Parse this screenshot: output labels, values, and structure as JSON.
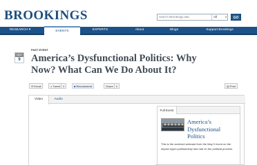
{
  "header": {
    "logo": "BROOKINGS",
    "search": {
      "placeholder": "Search Brookings.edu",
      "scope": "All",
      "go_label": "GO"
    }
  },
  "nav": {
    "items": [
      {
        "label": "RESEARCH ▾"
      },
      {
        "label": "EVENTS"
      },
      {
        "label": "EXPERTS"
      },
      {
        "label": "About"
      },
      {
        "label": "Blogs"
      },
      {
        "label": "Support Brookings"
      }
    ]
  },
  "event": {
    "type": "PAST EVENT",
    "date_month": "MAY",
    "date_day": "9",
    "title": "America’s Dysfunctional Politics: Why Now? What Can We Do About It?"
  },
  "share": {
    "email": "Email",
    "tweet": "Tweet",
    "tweet_count": "0",
    "recommend": "Recommend",
    "share": "Share",
    "share_count": "0",
    "print": "Print"
  },
  "media": {
    "tabs": [
      {
        "label": "Video"
      },
      {
        "label": "Audio"
      }
    ],
    "card": {
      "tab": "Full Event",
      "title": "America’s Dysfunctional Politics",
      "description": "This is the archived webcast from the May 9 event on the impact hyper-partisanship has had on the political process."
    }
  }
}
